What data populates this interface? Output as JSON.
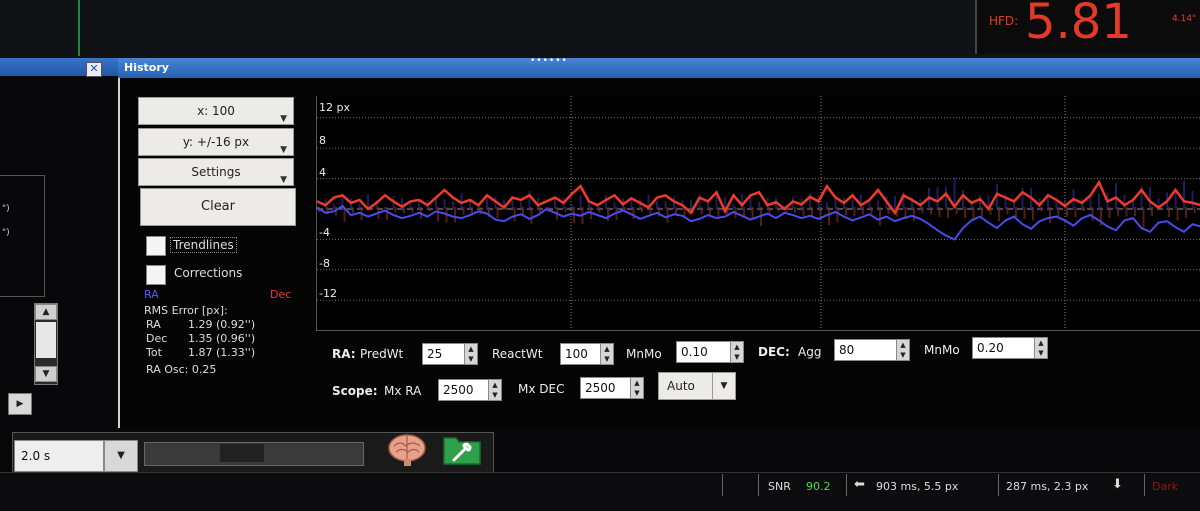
{
  "hfd": {
    "label": "HFD:",
    "value": "5.81",
    "extra": "4.14\""
  },
  "left_panel": {
    "close_icon": "close-icon",
    "quotes": [
      "\")",
      "\")"
    ]
  },
  "history": {
    "title": "History",
    "x_select": "x: 100",
    "y_select": "y: +/-16 px",
    "settings_select": "Settings",
    "clear_label": "Clear",
    "trendlines_label": "Trendlines",
    "corrections_label": "Corrections",
    "ra_label": "RA",
    "dec_label": "Dec",
    "rms_title": "RMS Error [px]:",
    "stats": [
      {
        "name": "RA",
        "value": "1.29 (0.92'')"
      },
      {
        "name": "Dec",
        "value": "1.35 (0.96'')"
      },
      {
        "name": "Tot",
        "value": "1.87 (1.33'')"
      }
    ],
    "ra_osc": "RA Osc: 0.25",
    "y_ticks": [
      "12 px",
      "8",
      "4",
      "-4",
      "-8",
      "-12"
    ]
  },
  "chart_data": {
    "type": "line",
    "ylim": [
      -16,
      16
    ],
    "series": [
      {
        "name": "RA",
        "color": "#4a4af0"
      },
      {
        "name": "Dec",
        "color": "#f03a2a"
      }
    ],
    "ra": [
      0.2,
      -0.5,
      -0.3,
      0.4,
      -0.8,
      -0.5,
      -1.0,
      -0.6,
      -0.2,
      -0.8,
      -1.2,
      -0.9,
      -0.5,
      -1.0,
      -0.3,
      -0.6,
      -1.0,
      -1.2,
      -0.8,
      -0.3,
      -0.6,
      -1.4,
      -1.6,
      -1.0,
      -0.7,
      -1.3,
      -0.8,
      0.0,
      -0.5,
      -1.0,
      -0.6,
      -0.9,
      -0.4,
      -0.8,
      -1.2,
      -0.6,
      -0.2,
      -0.7,
      -1.3,
      -0.9,
      -0.5,
      -1.1,
      -0.7,
      -0.9,
      -1.6,
      -1.3,
      -0.8,
      -1.2,
      -1.0,
      -0.4,
      -0.9,
      -1.4,
      -1.0,
      -0.6,
      -1.2,
      -0.5,
      -0.8,
      -1.2,
      -0.9,
      -1.3,
      -0.8,
      -0.4,
      -1.0,
      -1.5,
      -1.1,
      -0.7,
      -1.4,
      -1.0,
      -1.6,
      -1.2,
      -0.9,
      -1.3,
      -2.0,
      -2.8,
      -3.5,
      -4.0,
      -2.5,
      -1.5,
      -1.0,
      -1.8,
      -2.5,
      -1.5,
      -1.0,
      -2.0,
      -2.6,
      -1.6,
      -1.2,
      -1.0,
      -1.5,
      -2.2,
      -1.2,
      -0.8,
      -1.5,
      -2.3,
      -2.8,
      -1.5,
      -1.2,
      -2.5,
      -3.0,
      -1.8,
      -1.6,
      -2.4,
      -3.0,
      -2.0,
      -2.3
    ],
    "dec": [
      1.0,
      0.5,
      1.5,
      1.8,
      0.8,
      1.2,
      0.0,
      0.8,
      1.8,
      1.0,
      0.3,
      1.0,
      1.2,
      0.5,
      1.5,
      2.5,
      1.5,
      0.8,
      1.2,
      0.5,
      1.8,
      1.0,
      0.2,
      1.5,
      1.2,
      1.8,
      0.5,
      1.0,
      1.5,
      0.8,
      2.0,
      3.0,
      1.0,
      0.5,
      1.2,
      1.8,
      0.6,
      1.4,
      0.8,
      0.2,
      1.5,
      1.8,
      1.0,
      0.5,
      -0.5,
      1.5,
      1.0,
      2.2,
      -0.3,
      1.8,
      0.5,
      1.8,
      2.2,
      0.5,
      0.9,
      0.0,
      1.0,
      0.6,
      1.6,
      1.0,
      3.0,
      1.5,
      0.8,
      1.8,
      0.5,
      1.2,
      2.5,
      1.0,
      -0.5,
      1.8,
      1.2,
      0.5,
      1.5,
      1.0,
      2.0,
      0.3,
      1.8,
      0.8,
      1.3,
      0.0,
      2.0,
      1.5,
      1.0,
      2.2,
      1.5,
      0.5,
      1.8,
      1.2,
      0.4,
      1.3,
      0.8,
      1.8,
      3.5,
      1.0,
      1.5,
      0.5,
      1.2,
      2.5,
      1.0,
      0.2,
      1.0,
      2.5,
      1.0,
      0.8,
      0.5
    ]
  },
  "controls": {
    "ra_label": "RA:",
    "pred_wt_label": "PredWt",
    "pred_wt": "25",
    "react_wt_label": "ReactWt",
    "react_wt": "100",
    "mn_mo_label": "MnMo",
    "ra_mnmo": "0.10",
    "dec_label": "DEC:",
    "agg_label": "Agg",
    "dec_agg": "80",
    "dec_mnmo_label": "MnMo",
    "dec_mnmo": "0.20",
    "scope_label": "Scope:",
    "mx_ra_label": "Mx RA",
    "mx_ra": "2500",
    "mx_dec_label": "Mx DEC",
    "mx_dec": "2500",
    "auto_label": "Auto"
  },
  "bottom": {
    "exposure": "2.0 s",
    "snr_label": "SNR",
    "snr_value": "90.2",
    "ra_status": "903 ms, 5.5 px",
    "dec_status": "287 ms, 2.3 px",
    "dark_label": "Dark"
  }
}
